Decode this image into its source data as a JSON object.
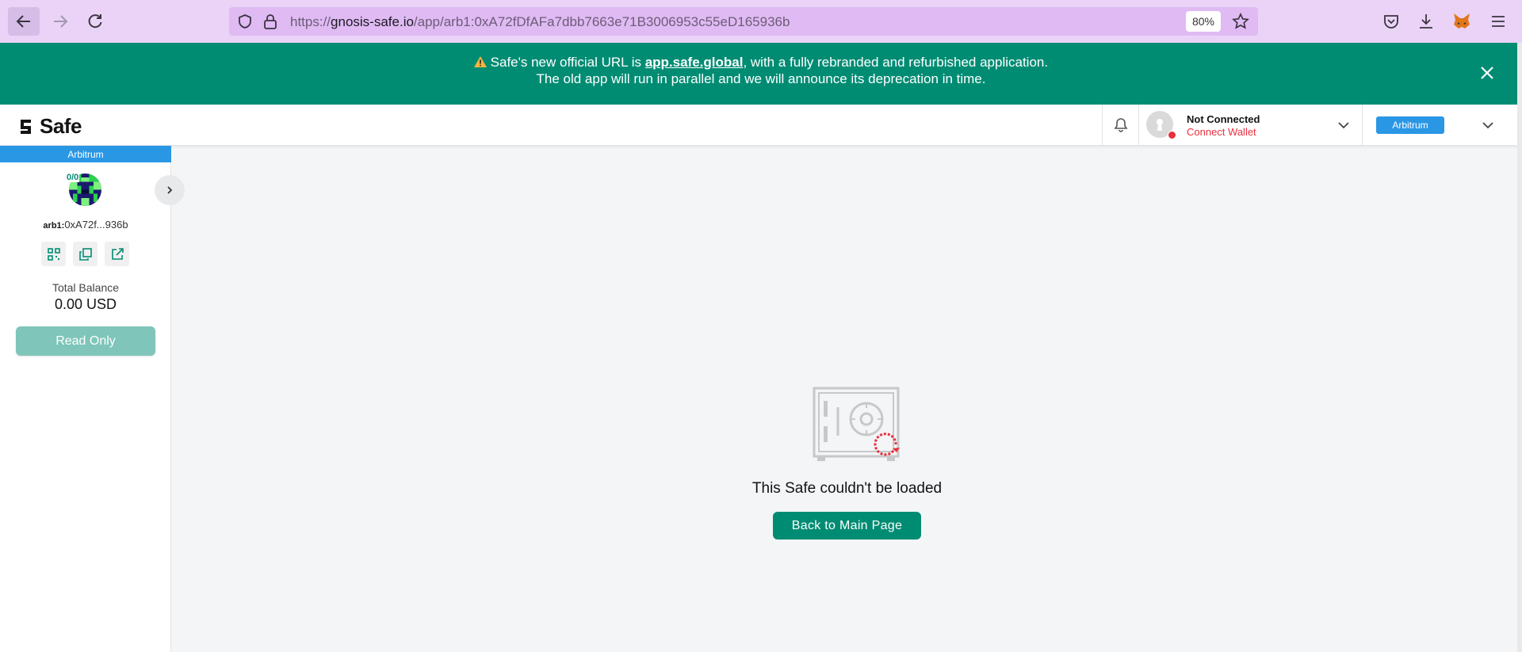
{
  "browser": {
    "url_prefix": "https://",
    "url_host": "gnosis-safe.io",
    "url_path": "/app/arb1:0xA72fDfAFa7dbb7663e71B3006953c55eD165936b",
    "zoom": "80%",
    "icons": [
      "back-arrow-icon",
      "forward-arrow-icon",
      "reload-icon",
      "shield-icon",
      "lock-icon",
      "star-icon",
      "pocket-icon",
      "download-icon",
      "metamask-fox-icon",
      "hamburger-menu-icon"
    ]
  },
  "banner": {
    "warning_icon": "warning-icon",
    "text_before": " Safe's new official URL is ",
    "link": "app.safe.global",
    "text_after": ", with a fully rebranded and refurbished application.",
    "line2": "The old app will run in parallel and we will announce its deprecation in time.",
    "bg_color": "#008c73"
  },
  "header": {
    "logo_text": "Safe",
    "wallet_status": "Not Connected",
    "wallet_action": "Connect Wallet",
    "network": "Arbitrum",
    "status_color": "#e8303e"
  },
  "sidebar": {
    "network": "Arbitrum",
    "threshold": "0/0",
    "address_prefix": "arb1:",
    "address_short": "0xA72f...936b",
    "actions": [
      "qr-code-icon",
      "copy-icon",
      "external-link-icon"
    ],
    "balance_label": "Total Balance",
    "balance_value": "0.00 USD",
    "readonly_label": "Read Only",
    "network_color": "#2a97e5"
  },
  "main": {
    "error_title": "This Safe couldn't be loaded",
    "back_button": "Back to Main Page",
    "accent": "#008c73"
  }
}
